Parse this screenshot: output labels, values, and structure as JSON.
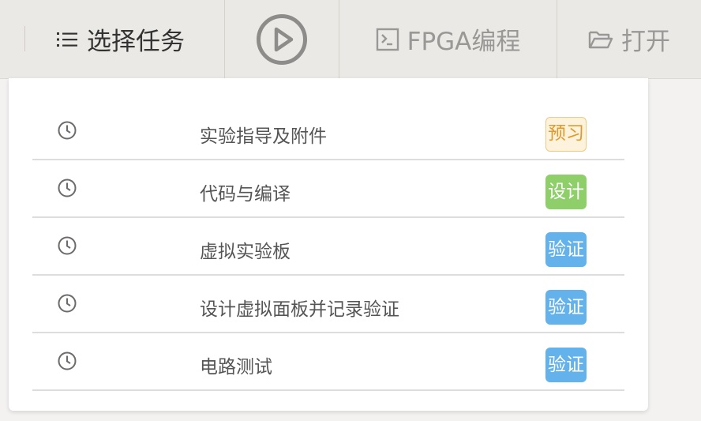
{
  "toolbar": {
    "select_task_label": "选择任务",
    "fpga_label": "FPGA编程",
    "open_label": "打开"
  },
  "tasks": [
    {
      "name": "实验指导及附件",
      "tag": "预习",
      "tag_type": "preview"
    },
    {
      "name": "代码与编译",
      "tag": "设计",
      "tag_type": "design"
    },
    {
      "name": "虚拟实验板",
      "tag": "验证",
      "tag_type": "verify"
    },
    {
      "name": "设计虚拟面板并记录验证",
      "tag": "验证",
      "tag_type": "verify"
    },
    {
      "name": "电路测试",
      "tag": "验证",
      "tag_type": "verify"
    }
  ],
  "colors": {
    "preview_bg": "#fdf3dc",
    "preview_text": "#e09a2c",
    "design": "#8fcf6a",
    "verify": "#64b2ec"
  },
  "icons": {
    "task_menu": "list-icon",
    "run": "play-circle-icon",
    "fpga": "terminal-icon",
    "open": "folder-open-icon",
    "task_status": "clock-icon"
  }
}
